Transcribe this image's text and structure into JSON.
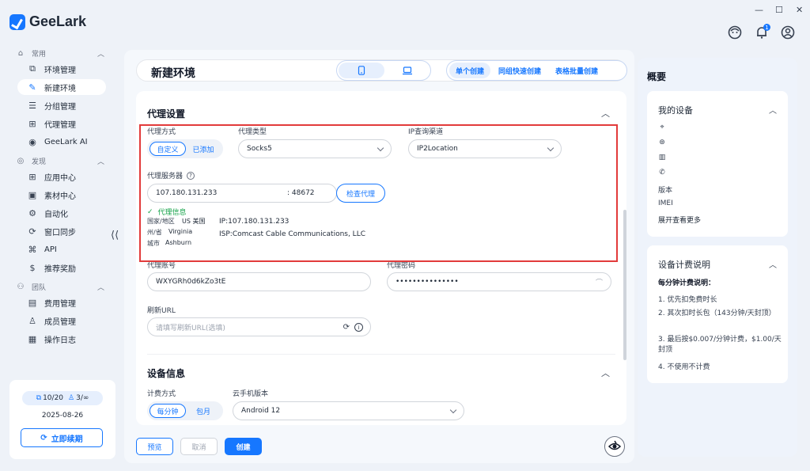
{
  "app": {
    "name": "GeeLark"
  },
  "window": {
    "minimize": "—",
    "maximize": "☐",
    "close": "✕"
  },
  "notifications": {
    "count": "1"
  },
  "sidebar": {
    "sections": [
      {
        "label": "常用"
      },
      {
        "label": "发现"
      },
      {
        "label": "团队"
      }
    ],
    "items": [
      {
        "label": "环境管理",
        "icon": "environment-icon"
      },
      {
        "label": "新建环境",
        "icon": "edit-icon"
      },
      {
        "label": "分组管理",
        "icon": "list-icon"
      },
      {
        "label": "代理管理",
        "icon": "proxy-icon"
      },
      {
        "label": "GeeLark AI",
        "icon": "ai-icon"
      },
      {
        "label": "应用中心",
        "icon": "apps-icon"
      },
      {
        "label": "素材中心",
        "icon": "materials-icon"
      },
      {
        "label": "自动化",
        "icon": "automation-icon"
      },
      {
        "label": "窗口同步",
        "icon": "sync-icon"
      },
      {
        "label": "API",
        "icon": "api-icon"
      },
      {
        "label": "推荐奖励",
        "icon": "dollar-icon"
      },
      {
        "label": "费用管理",
        "icon": "billing-icon"
      },
      {
        "label": "成员管理",
        "icon": "member-icon"
      },
      {
        "label": "操作日志",
        "icon": "log-icon"
      }
    ],
    "collapse": "⟨⟨",
    "account": {
      "devices": "10/20",
      "members": "3/∞",
      "date": "2025-08-26",
      "renew": "立即续期"
    }
  },
  "header": {
    "title": "新建环境",
    "tabs": [
      "单个创建",
      "同组快速创建",
      "表格批量创建"
    ]
  },
  "proxy": {
    "title": "代理设置",
    "method_label": "代理方式",
    "method_options": [
      "自定义",
      "已添加"
    ],
    "type_label": "代理类型",
    "type_value": "Socks5",
    "ipcheck_label": "IP查询渠道",
    "ipcheck_value": "IP2Location",
    "server_label": "代理服务器",
    "server_host": "107.180.131.233",
    "server_port": ": 48672",
    "check_button": "检查代理",
    "info_status": "代理信息",
    "info": {
      "country_key": "国家/地区",
      "country_val": "US 美国",
      "state_key": "州/省",
      "state_val": "Virginia",
      "city_key": "城市",
      "city_val": "Ashburn",
      "ip": "IP:107.180.131.233",
      "isp": "ISP:Comcast Cable Communications, LLC"
    },
    "account_label": "代理账号",
    "account_value": "WXYGRh0d6kZo3tE",
    "password_label": "代理密码",
    "password_value": "•••••••••••••••",
    "refresh_label": "刷新URL",
    "refresh_placeholder": "请填写刷新URL(选填)"
  },
  "device": {
    "title": "设备信息",
    "billing_label": "计费方式",
    "billing_options": [
      "每分钟",
      "包月"
    ],
    "android_label": "云手机版本",
    "android_value": "Android 12"
  },
  "footer": {
    "preview": "预览",
    "cancel": "取消",
    "create": "创建"
  },
  "overview": {
    "title": "概要",
    "my_device": "我的设备",
    "rows": [
      "版本",
      "IMEI",
      "展开查看更多"
    ],
    "billing_title": "设备计费说明",
    "billing_subtitle": "每分钟计费说明：",
    "billing_items": [
      "1. 优先扣免费时长",
      "2. 其次扣时长包（143分钟/天封顶）",
      "3. 最后按$0.007/分钟计费，$1.00/天封顶",
      "4. 不使用不计费"
    ]
  }
}
